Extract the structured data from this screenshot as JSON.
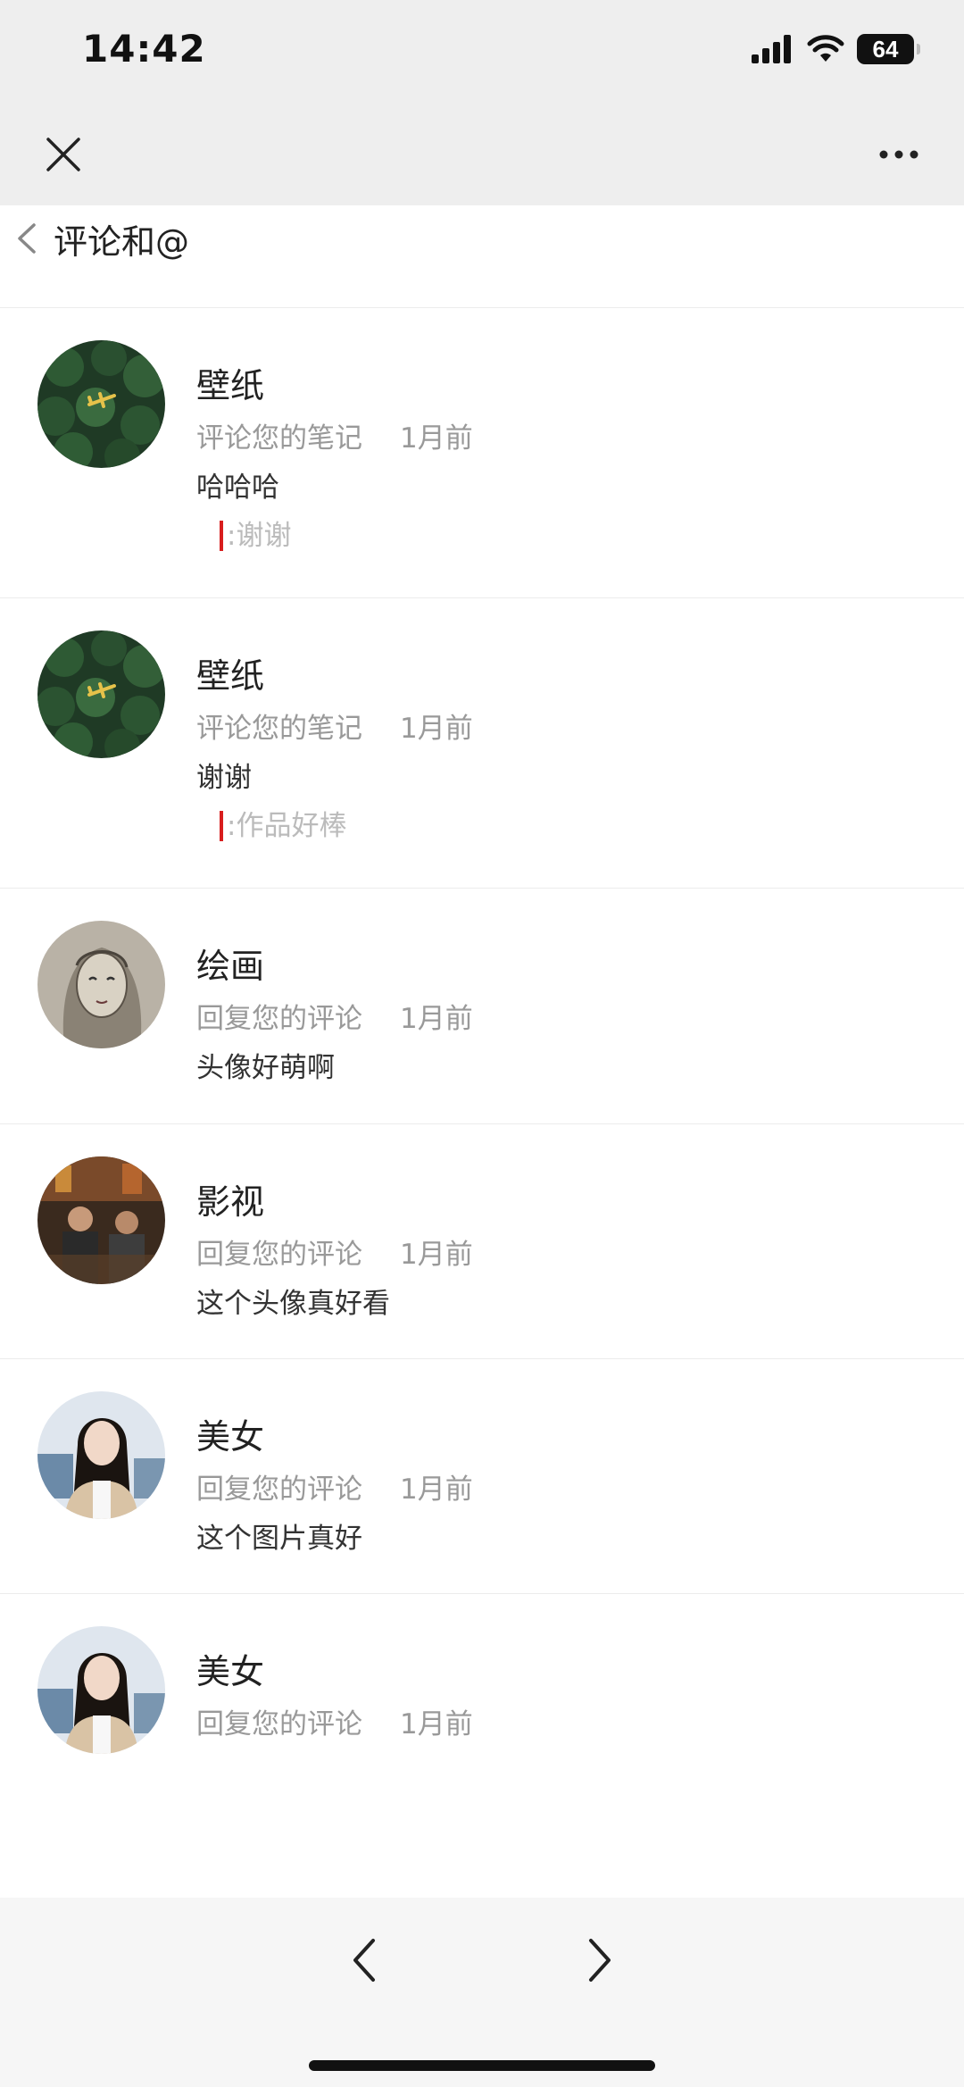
{
  "status_bar": {
    "time": "14:42",
    "battery": "64",
    "icons": [
      "cellular-signal-icon",
      "wifi-icon",
      "battery-icon"
    ]
  },
  "nav": {
    "icons": [
      "close-icon",
      "more-icon"
    ]
  },
  "header": {
    "title": "评论和@",
    "icon": "back-icon"
  },
  "comments": [
    {
      "name": "壁纸",
      "action": "评论您的笔记",
      "time": "1月前",
      "content": "哈哈哈",
      "quote": ":谢谢",
      "avatar": "forest-airplane"
    },
    {
      "name": "壁纸",
      "action": "评论您的笔记",
      "time": "1月前",
      "content": "谢谢",
      "quote": ":作品好棒",
      "avatar": "forest-airplane"
    },
    {
      "name": "绘画",
      "action": "回复您的评论",
      "time": "1月前",
      "content": "头像好萌啊",
      "avatar": "sketch-girl"
    },
    {
      "name": "影视",
      "action": "回复您的评论",
      "time": "1月前",
      "content": "这个头像真好看",
      "avatar": "movie-still"
    },
    {
      "name": "美女",
      "action": "回复您的评论",
      "time": "1月前",
      "content": "这个图片真好",
      "avatar": "woman-portrait"
    },
    {
      "name": "美女",
      "action": "回复您的评论",
      "time": "1月前",
      "avatar": "woman-portrait"
    }
  ],
  "bottom_nav": {
    "icons": [
      "chevron-left-icon",
      "chevron-right-icon"
    ]
  },
  "colors": {
    "quote_bar": "#d81e1e",
    "bar_background": "#eeeeee",
    "muted_text": "#999999"
  }
}
